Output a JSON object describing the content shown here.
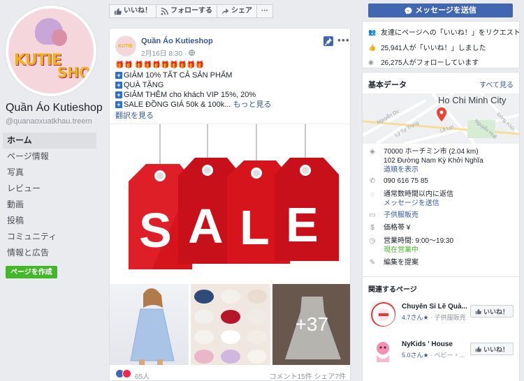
{
  "page": {
    "name": "Quần Áo Kutieshop",
    "handle": "@quanaoxuatkhau.treem",
    "avatar_text": [
      "KUTIE",
      "SHOP"
    ]
  },
  "left_nav": {
    "items": [
      {
        "label": "ホーム",
        "active": true
      },
      {
        "label": "ページ情報"
      },
      {
        "label": "写真"
      },
      {
        "label": "レビュー"
      },
      {
        "label": "動画"
      },
      {
        "label": "投稿"
      },
      {
        "label": "コミュニティ"
      },
      {
        "label": "情報と広告"
      }
    ],
    "create_page": "ページを作成"
  },
  "actionbar": {
    "like": "いいね！",
    "follow": "フォローする",
    "share": "シェア",
    "more": "···",
    "message": "メッセージを送信"
  },
  "post": {
    "author": "Quần Áo Kutieshop",
    "time": "2月16日 8:30 ·",
    "emoji_line": "🎁🎁 🎁🎁🎁🎁🎁🎁🎁🎁",
    "lines": [
      "GIẢM 10% TẤT CẢ SẢN PHẨM",
      "QUÀ TẶNG",
      "GIẢM THÊM cho khách VIP 15%, 20%",
      "SALE ĐỒNG GIÁ 50k & 100k..."
    ],
    "see_more": "もっと見る",
    "translate": "翻訳を見る",
    "sale_word": "SALE",
    "more_photos": "+37",
    "reactions_count": "65人",
    "comments_shares": "コメント15件 シェア7件"
  },
  "stats": {
    "invite": "友達にページへの「いいね！」をリクエスト",
    "invite_highlight": "友達",
    "likes": "25,941人が「いいね！」しました",
    "follows": "26,275人がフォローしています"
  },
  "basic_info": {
    "title": "基本データ",
    "see_all": "すべて見る",
    "map_label": "Ho Chi Minh City",
    "map_streets": [
      "Nguyễn Du",
      "Lý Tự Trọng",
      "Lê Lợi",
      "Nguyễn Huệ",
      "Đồng Khởi"
    ],
    "address1": "70000 ホーチミン市 (2.04 km)",
    "address2": "102 Đường Nam Kỳ Khởi Nghĩa",
    "directions": "道順を表示",
    "phone": "090 616 75 85",
    "response": "通常数時間以内に返信",
    "send_message": "メッセージを送信",
    "category": "子供服販売",
    "price": "価格帯 ¥",
    "hours": "営業時間: 9:00～19:30",
    "open_now": "現在営業中",
    "suggest_edit": "編集を提案"
  },
  "related": {
    "title": "関連するページ",
    "items": [
      {
        "name": "Chuyên Sỉ Lê Quả...",
        "rating": "4.7さん",
        "category": "· 子供服販売",
        "like": "いいね！"
      },
      {
        "name": "NyKids ' House",
        "rating": "5.0さん",
        "category": "· ベビー・...",
        "like": "いいね！"
      }
    ]
  },
  "colors": {
    "fb_blue": "#4267b2",
    "link": "#385898",
    "sale_red": "#d6141c",
    "green": "#42b72a"
  }
}
